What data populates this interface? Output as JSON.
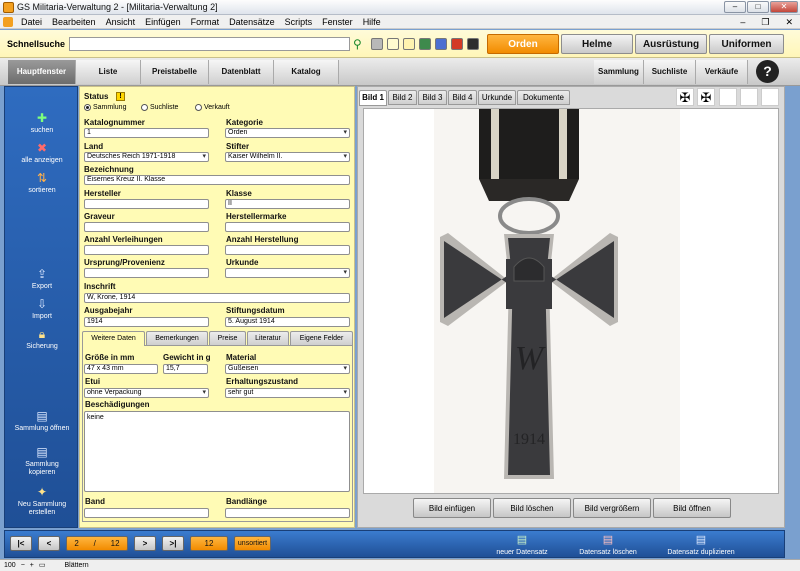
{
  "window": {
    "title": "GS Militaria-Verwaltung 2 - [Militaria-Verwaltung 2]"
  },
  "menu": [
    "Datei",
    "Bearbeiten",
    "Ansicht",
    "Einfügen",
    "Format",
    "Datensätze",
    "Scripts",
    "Fenster",
    "Hilfe"
  ],
  "quicksearch": {
    "label": "Schnellsuche",
    "value": ""
  },
  "swatch_colors": [
    "#b8b8b8",
    "#fffbd0",
    "#fff3b0",
    "#3e8a4c",
    "#4d6fd1",
    "#d33a26",
    "#2d2d2d"
  ],
  "top_buttons": [
    "Orden",
    "Helme",
    "Ausrüstung",
    "Uniformen"
  ],
  "nav_tabs": [
    "Hauptfenster",
    "Liste",
    "Preistabelle",
    "Datenblatt",
    "Katalog"
  ],
  "nav_right": [
    "Sammlung",
    "Suchliste",
    "Verkäufe"
  ],
  "help": "?",
  "sidebar": {
    "search": "suchen",
    "show_all": "alle anzeigen",
    "sort": "sortieren",
    "export": "Export",
    "import": "Import",
    "backup": "Sicherung",
    "open": "Sammlung öffnen",
    "copy": "Sammlung kopieren",
    "new": "Neu Sammlung erstellen"
  },
  "form": {
    "status_label": "Status",
    "status_badge": "!",
    "status_options": [
      "Sammlung",
      "Suchliste",
      "Verkauft"
    ],
    "katalognummer_label": "Katalognummer",
    "katalognummer": "1",
    "kategorie_label": "Kategorie",
    "kategorie": "Orden",
    "land_label": "Land",
    "land": "Deutsches Reich 1971-1918",
    "stifter_label": "Stifter",
    "stifter": "Kaiser Wilhelm II.",
    "bezeichnung_label": "Bezeichnung",
    "bezeichnung": "Eisernes Kreuz II. Klasse",
    "hersteller_label": "Hersteller",
    "hersteller": "",
    "klasse_label": "Klasse",
    "klasse": "II",
    "graveur_label": "Graveur",
    "graveur": "",
    "herstellermarke_label": "Herstellermarke",
    "herstellermarke": "",
    "verleihungen_label": "Anzahl Verleihungen",
    "verleihungen": "",
    "herstellung_label": "Anzahl Herstellung",
    "herstellung": "",
    "provenienz_label": "Ursprung/Provenienz",
    "provenienz": "",
    "urkunde_label": "Urkunde",
    "urkunde": "",
    "inschrift_label": "Inschrift",
    "inschrift": "W, Krone, 1914",
    "ausgabejahr_label": "Ausgabejahr",
    "ausgabejahr": "1914",
    "stiftungsdatum_label": "Stiftungsdatum",
    "stiftungsdatum": "5. August 1914"
  },
  "subtabs": [
    "Weitere Daten",
    "Bemerkungen",
    "Preise",
    "Literatur",
    "Eigene Felder"
  ],
  "details": {
    "groesse_label": "Größe in mm",
    "groesse": "47 x 43 mm",
    "gewicht_label": "Gewicht in g",
    "gewicht": "15,7",
    "material_label": "Material",
    "material": "Gußeisen",
    "etui_label": "Etui",
    "etui": "ohne Verpackung",
    "erhaltung_label": "Erhaltungszustand",
    "erhaltung": "sehr gut",
    "beschaedigungen_label": "Beschädigungen",
    "beschaedigungen": "keine",
    "band_label": "Band",
    "band": "",
    "bandlaenge_label": "Bandlänge",
    "bandlaenge": ""
  },
  "image_tabs": [
    "Bild 1",
    "Bild 2",
    "Bild 3",
    "Bild 4",
    "Urkunde",
    "Dokumente"
  ],
  "cross_glyph": "✠",
  "medal": {
    "initial": "W",
    "year": "1914"
  },
  "image_buttons": [
    "Bild einfügen",
    "Bild löschen",
    "Bild vergrößern",
    "Bild öffnen"
  ],
  "record_nav": {
    "first": "|<",
    "prev": "<",
    "current": "2",
    "sep": "/",
    "total": "12",
    "next": ">",
    "last": ">|",
    "found": "12",
    "sort_state": "unsortiert"
  },
  "record_actions": [
    "neuer Datensatz",
    "Datensatz löschen",
    "Datensatz duplizieren"
  ],
  "statusbar": {
    "zoom": "100",
    "mode": "Blättern"
  }
}
